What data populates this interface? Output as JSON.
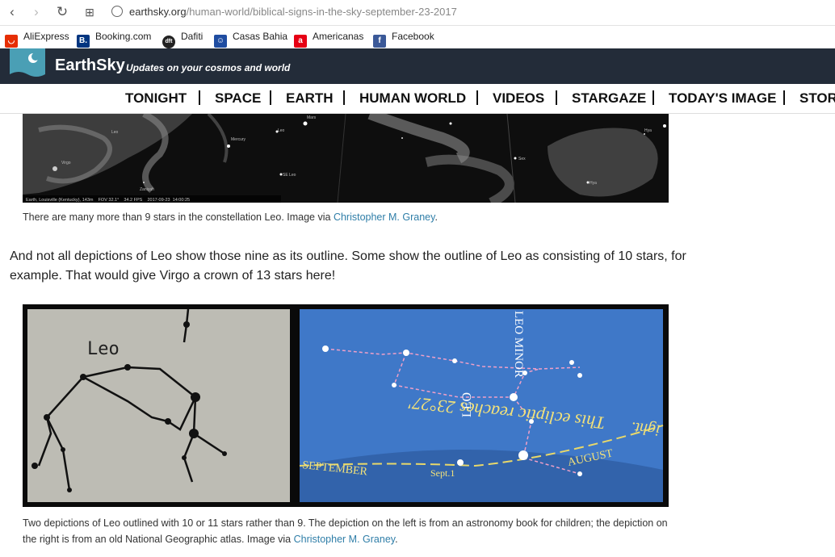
{
  "browser": {
    "url_domain": "earthsky.org",
    "url_path": "/human-world/biblical-signs-in-the-sky-september-23-2017",
    "bookmarks": [
      {
        "label": "AliExpress",
        "icon": "aliexpress-icon",
        "color": "#e62e04"
      },
      {
        "label": "Booking.com",
        "icon": "booking-icon",
        "color": "#003580"
      },
      {
        "label": "Dafiti",
        "icon": "dafiti-icon",
        "color": "#222222"
      },
      {
        "label": "Casas Bahia",
        "icon": "casas-bahia-icon",
        "color": "#1f4da1"
      },
      {
        "label": "Americanas",
        "icon": "americanas-icon",
        "color": "#e60014"
      },
      {
        "label": "Facebook",
        "icon": "facebook-icon",
        "color": "#3b5998"
      }
    ]
  },
  "site": {
    "name": "EarthSky",
    "tagline": "Updates on your cosmos and world",
    "nav": [
      "TONIGHT",
      "SPACE",
      "EARTH",
      "HUMAN WORLD",
      "VIDEOS",
      "STARGAZE",
      "TODAY'S IMAGE",
      "STOR"
    ]
  },
  "article": {
    "figure1": {
      "labels": [
        "Leo",
        "Mercury",
        "Mars",
        "Leo",
        "Sex",
        "Hya",
        "SE Leo",
        "Zaniyah",
        "Virgo",
        "Hya"
      ],
      "status": "Earth, Louisville (Kentucky), 143m    FOV 32.1°    34.2 FPS    2017-09-23  14:00:25",
      "caption_text": "There are many more than 9 stars in the constellation Leo. Image via ",
      "caption_link": "Christopher M. Graney",
      "caption_end": "."
    },
    "paragraph": "And not all depictions of Leo show those nine as its outline. Some show the outline of Leo as consisting of 10 stars, for example. That would give Virgo a crown of 13 stars here!",
    "figure2": {
      "left_label": "Leo",
      "right_labels": {
        "leo": "LEO",
        "leo_minor": "LEO MINOR",
        "ecliptic": "This ecliptic reaches 23°27'",
        "september": "SEPTEMBER",
        "sept1": "Sept.1",
        "august": "AUGUST",
        "light": "ight."
      },
      "caption_text": "Two depictions of Leo outlined with 10 or 11 stars rather than 9. The depiction on the left is from an astronomy book for children; the depiction on the right is from an old National Geographic atlas. Image via ",
      "caption_link": "Christopher M. Graney",
      "caption_end": "."
    }
  }
}
